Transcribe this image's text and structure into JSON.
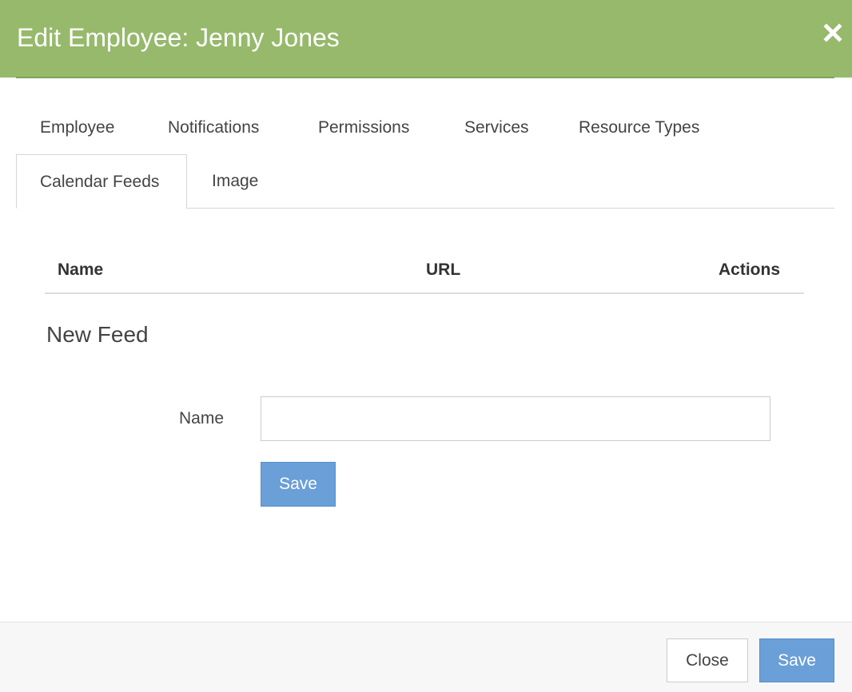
{
  "header": {
    "title": "Edit Employee: Jenny Jones",
    "close_icon": "close-x-icon",
    "background_color": "#96b96b"
  },
  "tabs": [
    {
      "label": "Employee",
      "active": false
    },
    {
      "label": "Notifications",
      "active": false
    },
    {
      "label": "Permissions",
      "active": false
    },
    {
      "label": "Services",
      "active": false
    },
    {
      "label": "Resource Types",
      "active": false
    },
    {
      "label": "Calendar Feeds",
      "active": true
    },
    {
      "label": "Image",
      "active": false
    }
  ],
  "table": {
    "columns": [
      "Name",
      "URL",
      "Actions"
    ],
    "rows": []
  },
  "new_feed": {
    "title": "New Feed",
    "name_label": "Name",
    "name_value": "",
    "name_placeholder": "",
    "save_label": "Save"
  },
  "footer": {
    "close_label": "Close",
    "save_label": "Save"
  },
  "colors": {
    "primary_button": "#6a9fd8"
  }
}
